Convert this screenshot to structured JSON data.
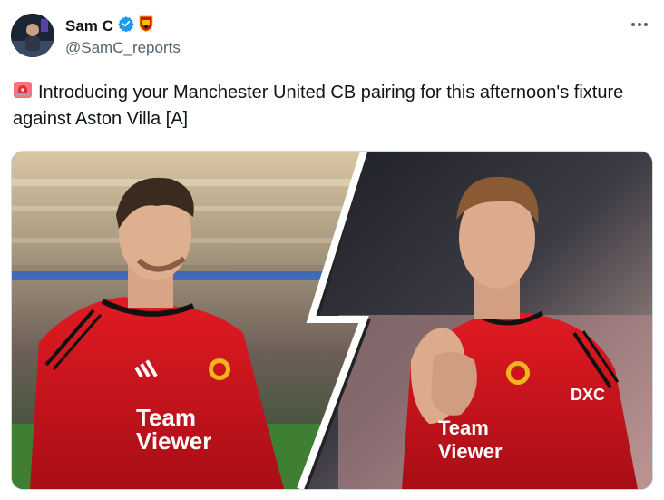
{
  "tweet": {
    "author": {
      "display_name": "Sam C",
      "handle": "@SamC_reports",
      "avatar_icon": "avatar-photo",
      "verified_icon": "verified-badge-icon",
      "club_badge_icon": "man-utd-crest-icon"
    },
    "text": "Introducing your Manchester United CB pairing for this afternoon's fixture against Aston Villa [A]",
    "text_prefix_icon": "siren-emoji-icon",
    "more_icon": "more-options-icon"
  },
  "media": {
    "left_player": {
      "shirt_sponsor": "Team Viewer"
    },
    "right_player": {
      "shirt_sponsor": "Team Viewer",
      "sleeve_sponsor": "DXC"
    },
    "colors": {
      "shirt_red": "#d0121b",
      "verified_blue": "#1d9bf0"
    }
  }
}
